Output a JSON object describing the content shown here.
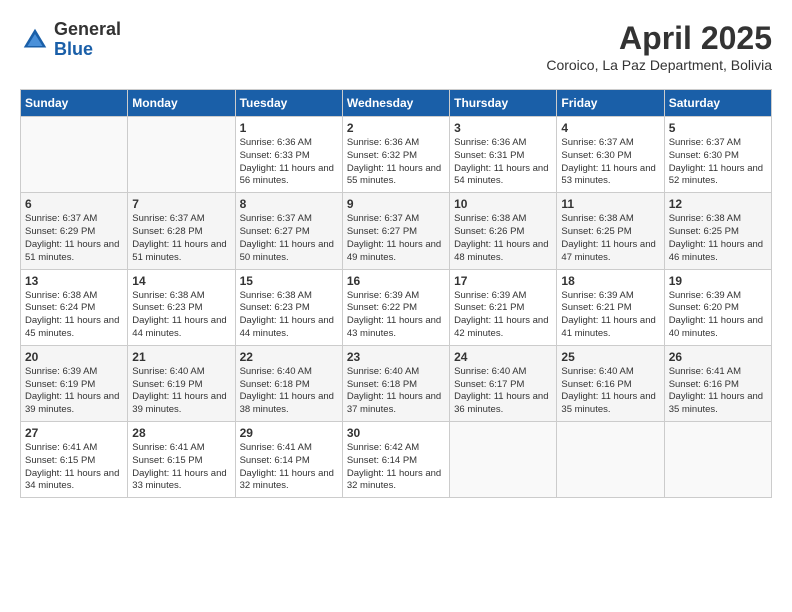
{
  "header": {
    "logo_general": "General",
    "logo_blue": "Blue",
    "month_year": "April 2025",
    "location": "Coroico, La Paz Department, Bolivia"
  },
  "days_of_week": [
    "Sunday",
    "Monday",
    "Tuesday",
    "Wednesday",
    "Thursday",
    "Friday",
    "Saturday"
  ],
  "weeks": [
    [
      {
        "day": "",
        "info": ""
      },
      {
        "day": "",
        "info": ""
      },
      {
        "day": "1",
        "info": "Sunrise: 6:36 AM\nSunset: 6:33 PM\nDaylight: 11 hours and 56 minutes."
      },
      {
        "day": "2",
        "info": "Sunrise: 6:36 AM\nSunset: 6:32 PM\nDaylight: 11 hours and 55 minutes."
      },
      {
        "day": "3",
        "info": "Sunrise: 6:36 AM\nSunset: 6:31 PM\nDaylight: 11 hours and 54 minutes."
      },
      {
        "day": "4",
        "info": "Sunrise: 6:37 AM\nSunset: 6:30 PM\nDaylight: 11 hours and 53 minutes."
      },
      {
        "day": "5",
        "info": "Sunrise: 6:37 AM\nSunset: 6:30 PM\nDaylight: 11 hours and 52 minutes."
      }
    ],
    [
      {
        "day": "6",
        "info": "Sunrise: 6:37 AM\nSunset: 6:29 PM\nDaylight: 11 hours and 51 minutes."
      },
      {
        "day": "7",
        "info": "Sunrise: 6:37 AM\nSunset: 6:28 PM\nDaylight: 11 hours and 51 minutes."
      },
      {
        "day": "8",
        "info": "Sunrise: 6:37 AM\nSunset: 6:27 PM\nDaylight: 11 hours and 50 minutes."
      },
      {
        "day": "9",
        "info": "Sunrise: 6:37 AM\nSunset: 6:27 PM\nDaylight: 11 hours and 49 minutes."
      },
      {
        "day": "10",
        "info": "Sunrise: 6:38 AM\nSunset: 6:26 PM\nDaylight: 11 hours and 48 minutes."
      },
      {
        "day": "11",
        "info": "Sunrise: 6:38 AM\nSunset: 6:25 PM\nDaylight: 11 hours and 47 minutes."
      },
      {
        "day": "12",
        "info": "Sunrise: 6:38 AM\nSunset: 6:25 PM\nDaylight: 11 hours and 46 minutes."
      }
    ],
    [
      {
        "day": "13",
        "info": "Sunrise: 6:38 AM\nSunset: 6:24 PM\nDaylight: 11 hours and 45 minutes."
      },
      {
        "day": "14",
        "info": "Sunrise: 6:38 AM\nSunset: 6:23 PM\nDaylight: 11 hours and 44 minutes."
      },
      {
        "day": "15",
        "info": "Sunrise: 6:38 AM\nSunset: 6:23 PM\nDaylight: 11 hours and 44 minutes."
      },
      {
        "day": "16",
        "info": "Sunrise: 6:39 AM\nSunset: 6:22 PM\nDaylight: 11 hours and 43 minutes."
      },
      {
        "day": "17",
        "info": "Sunrise: 6:39 AM\nSunset: 6:21 PM\nDaylight: 11 hours and 42 minutes."
      },
      {
        "day": "18",
        "info": "Sunrise: 6:39 AM\nSunset: 6:21 PM\nDaylight: 11 hours and 41 minutes."
      },
      {
        "day": "19",
        "info": "Sunrise: 6:39 AM\nSunset: 6:20 PM\nDaylight: 11 hours and 40 minutes."
      }
    ],
    [
      {
        "day": "20",
        "info": "Sunrise: 6:39 AM\nSunset: 6:19 PM\nDaylight: 11 hours and 39 minutes."
      },
      {
        "day": "21",
        "info": "Sunrise: 6:40 AM\nSunset: 6:19 PM\nDaylight: 11 hours and 39 minutes."
      },
      {
        "day": "22",
        "info": "Sunrise: 6:40 AM\nSunset: 6:18 PM\nDaylight: 11 hours and 38 minutes."
      },
      {
        "day": "23",
        "info": "Sunrise: 6:40 AM\nSunset: 6:18 PM\nDaylight: 11 hours and 37 minutes."
      },
      {
        "day": "24",
        "info": "Sunrise: 6:40 AM\nSunset: 6:17 PM\nDaylight: 11 hours and 36 minutes."
      },
      {
        "day": "25",
        "info": "Sunrise: 6:40 AM\nSunset: 6:16 PM\nDaylight: 11 hours and 35 minutes."
      },
      {
        "day": "26",
        "info": "Sunrise: 6:41 AM\nSunset: 6:16 PM\nDaylight: 11 hours and 35 minutes."
      }
    ],
    [
      {
        "day": "27",
        "info": "Sunrise: 6:41 AM\nSunset: 6:15 PM\nDaylight: 11 hours and 34 minutes."
      },
      {
        "day": "28",
        "info": "Sunrise: 6:41 AM\nSunset: 6:15 PM\nDaylight: 11 hours and 33 minutes."
      },
      {
        "day": "29",
        "info": "Sunrise: 6:41 AM\nSunset: 6:14 PM\nDaylight: 11 hours and 32 minutes."
      },
      {
        "day": "30",
        "info": "Sunrise: 6:42 AM\nSunset: 6:14 PM\nDaylight: 11 hours and 32 minutes."
      },
      {
        "day": "",
        "info": ""
      },
      {
        "day": "",
        "info": ""
      },
      {
        "day": "",
        "info": ""
      }
    ]
  ]
}
